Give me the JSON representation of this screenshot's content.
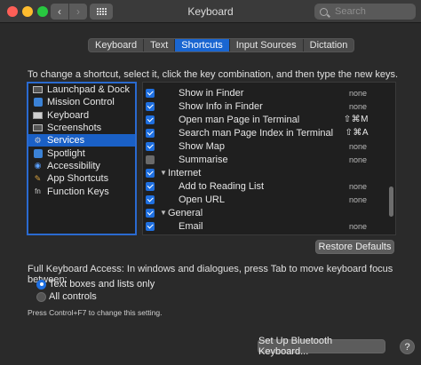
{
  "window": {
    "title": "Keyboard"
  },
  "search": {
    "placeholder": "Search"
  },
  "tabs": [
    {
      "label": "Keyboard",
      "active": false
    },
    {
      "label": "Text",
      "active": false
    },
    {
      "label": "Shortcuts",
      "active": true
    },
    {
      "label": "Input Sources",
      "active": false
    },
    {
      "label": "Dictation",
      "active": false
    }
  ],
  "instruction": "To change a shortcut, select it, click the key combination, and then type the new keys.",
  "categories": [
    {
      "label": "Launchpad & Dock",
      "icon": "launchpad-dock-icon",
      "selected": false
    },
    {
      "label": "Mission Control",
      "icon": "mission-control-icon",
      "selected": false
    },
    {
      "label": "Keyboard",
      "icon": "keyboard-icon",
      "selected": false
    },
    {
      "label": "Screenshots",
      "icon": "screenshots-icon",
      "selected": false
    },
    {
      "label": "Services",
      "icon": "gear-icon",
      "selected": true
    },
    {
      "label": "Spotlight",
      "icon": "spotlight-icon",
      "selected": false
    },
    {
      "label": "Accessibility",
      "icon": "accessibility-icon",
      "selected": false
    },
    {
      "label": "App Shortcuts",
      "icon": "app-shortcuts-icon",
      "selected": false
    },
    {
      "label": "Function Keys",
      "icon": "function-keys-icon",
      "selected": false
    }
  ],
  "shortcuts": [
    {
      "label": "Show in Finder",
      "key": "none",
      "checked": true,
      "group": false
    },
    {
      "label": "Show Info in Finder",
      "key": "none",
      "checked": true,
      "group": false
    },
    {
      "label": "Open man Page in Terminal",
      "key": "⇧⌘M",
      "checked": true,
      "group": false
    },
    {
      "label": "Search man Page Index in Terminal",
      "key": "⇧⌘A",
      "checked": true,
      "group": false
    },
    {
      "label": "Show Map",
      "key": "none",
      "checked": true,
      "group": false
    },
    {
      "label": "Summarise",
      "key": "none",
      "checked": false,
      "group": false
    },
    {
      "label": "Internet",
      "key": "",
      "checked": true,
      "group": true
    },
    {
      "label": "Add to Reading List",
      "key": "none",
      "checked": true,
      "group": false
    },
    {
      "label": "Open URL",
      "key": "none",
      "checked": true,
      "group": false
    },
    {
      "label": "General",
      "key": "",
      "checked": true,
      "group": true
    },
    {
      "label": "Email",
      "key": "none",
      "checked": true,
      "group": false
    }
  ],
  "buttons": {
    "restore": "Restore Defaults",
    "bluetooth": "Set Up Bluetooth Keyboard...",
    "help": "?"
  },
  "full_keyboard_access": {
    "label": "Full Keyboard Access: In windows and dialogues, press Tab to move keyboard focus between:",
    "options": [
      {
        "label": "Text boxes and lists only",
        "selected": true
      },
      {
        "label": "All controls",
        "selected": false
      }
    ],
    "hint": "Press Control+F7 to change this setting."
  },
  "colors": {
    "accent": "#1a66d1",
    "window": "#2a2a2a",
    "list": "#1f1f1f"
  }
}
